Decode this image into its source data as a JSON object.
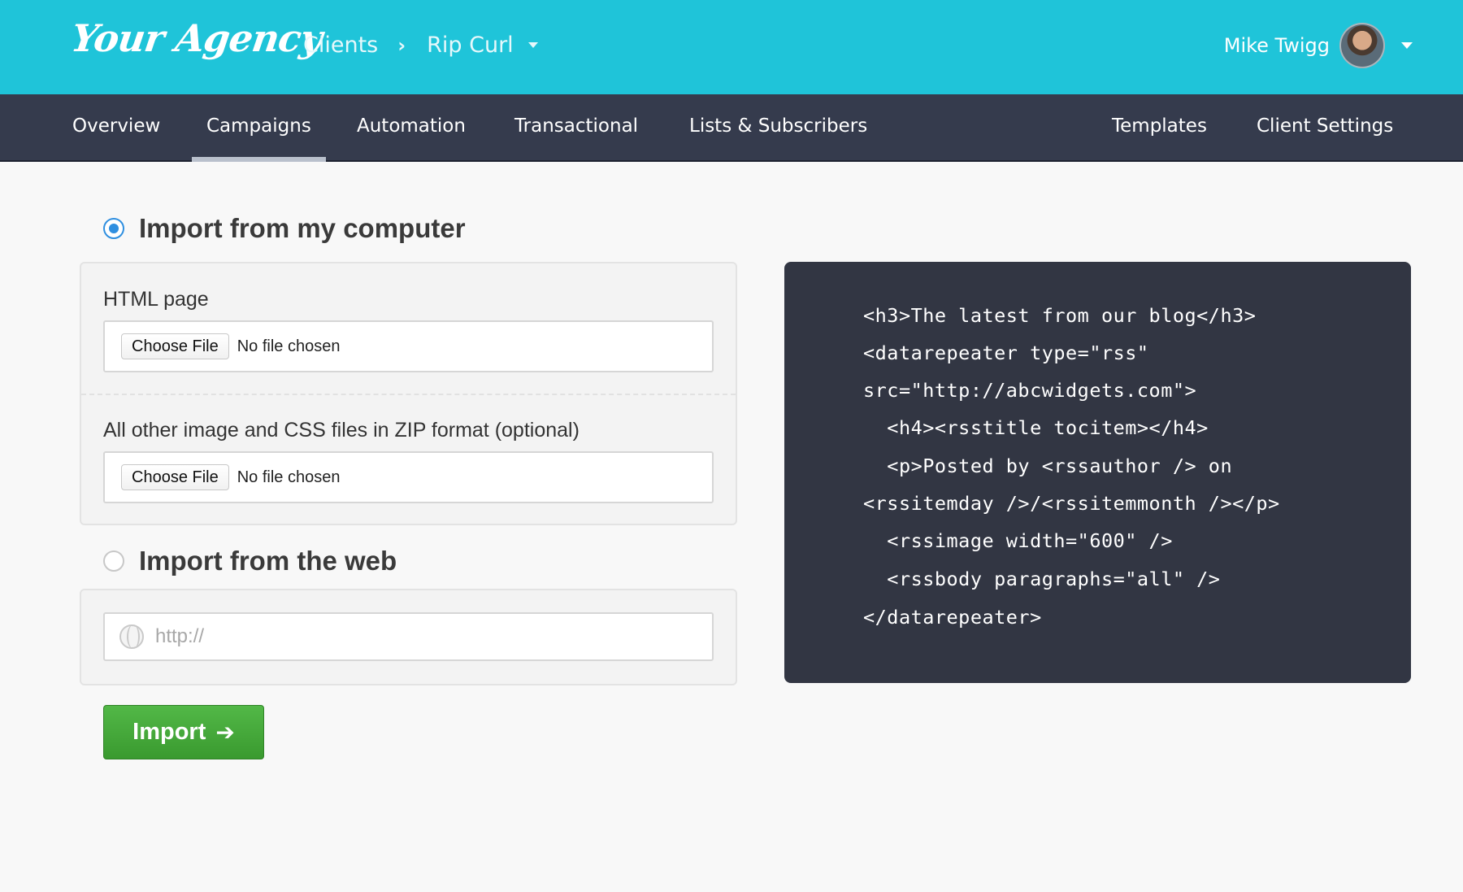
{
  "header": {
    "logo": "Your Agency",
    "breadcrumb": {
      "root": "Clients",
      "separator": "›",
      "current": "Rip Curl"
    },
    "user": {
      "name": "Mike Twigg"
    },
    "colors": {
      "topbar": "#1fc4d9",
      "nav": "#353b4d"
    }
  },
  "nav": {
    "items": [
      {
        "label": "Overview"
      },
      {
        "label": "Campaigns",
        "active": true
      },
      {
        "label": "Automation"
      },
      {
        "label": "Transactional"
      },
      {
        "label": "Lists & Subscribers"
      },
      {
        "label": "Templates"
      },
      {
        "label": "Client Settings"
      }
    ]
  },
  "import_computer": {
    "title": "Import from my computer",
    "selected": true,
    "html_label": "HTML page",
    "html_button": "Choose File",
    "html_status": "No file chosen",
    "zip_label": "All other image and CSS files in ZIP format (optional)",
    "zip_button": "Choose File",
    "zip_status": "No file chosen"
  },
  "import_web": {
    "title": "Import from the web",
    "selected": false,
    "url_placeholder": "http://",
    "url_value": ""
  },
  "import_button": {
    "label": "Import",
    "icon": "arrow-right-icon"
  },
  "code_sample": {
    "lines": [
      "<h3>The latest from our blog</h3>",
      "<datarepeater type=\"rss\"",
      "src=\"http://abcwidgets.com\">",
      "  <h4><rsstitle tocitem></h4>",
      "  <p>Posted by <rssauthor /> on",
      "<rssitemday />/<rssitemmonth /></p>",
      "  <rssimage width=\"600\" />",
      "  <rssbody paragraphs=\"all\" />",
      "</datarepeater>"
    ]
  }
}
